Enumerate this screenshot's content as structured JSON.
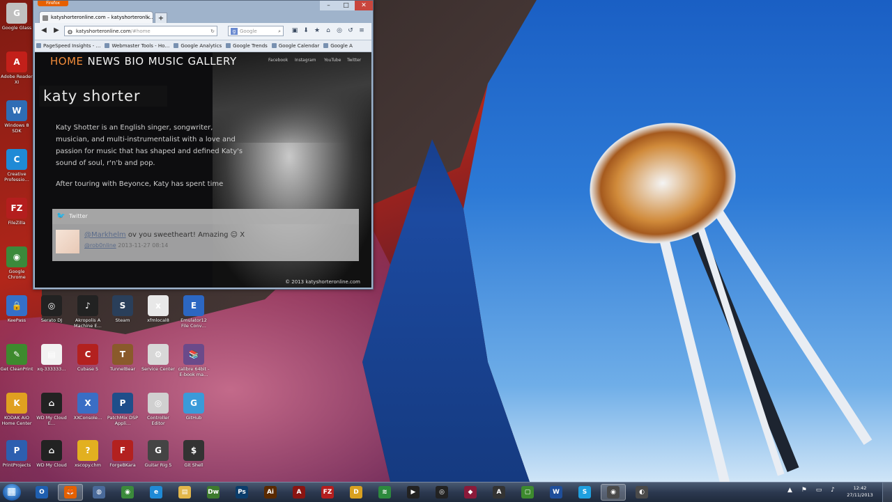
{
  "browser": {
    "app_button": "Firefox",
    "window_controls": {
      "minimize": "–",
      "maximize": "□",
      "close": "✕"
    },
    "tab": {
      "title": "katyshorteronline.com – katyshorteronli…",
      "close": "✕"
    },
    "new_tab": "+",
    "url": {
      "host": "katyshorteronline.com",
      "path": "/#home"
    },
    "search_placeholder": "Google",
    "bookmarks": [
      "PageSpeed Insights - …",
      "Webmaster Tools - Ho…",
      "Google Analytics",
      "Google Trends",
      "Google Calendar",
      "Google A"
    ]
  },
  "site": {
    "nav": [
      "HOME",
      "NEWS",
      "BIO",
      "MUSIC",
      "GALLERY"
    ],
    "active_nav": "HOME",
    "social": [
      "Facebook",
      "Instagram",
      "YouTube",
      "Twitter"
    ],
    "logo": "katy shorter",
    "bio_paragraph_1": "Katy Shotter is an English singer, songwriter, musician, and multi-instrumentalist with a love and passion for music that has shaped and defined Katy's sound of soul, r'n'b and pop.",
    "bio_paragraph_2": "After touring with Beyonce, Katy has spent time",
    "tweet": {
      "account": "Twitter",
      "handle": "@Markhelm",
      "text": "ov you sweetheart! Amazing ☺ X",
      "via": "@rob0nline",
      "meta": "2013-11-27 08:14"
    },
    "footer": "© 2013 katyshorteronline.com"
  },
  "desktop_icons": [
    {
      "label": "Google Glass",
      "color": "#c0c0c0",
      "glyph": "G"
    },
    {
      "label": "Adobe Reader XI",
      "color": "#c3201a",
      "glyph": "A"
    },
    {
      "label": "Windows 8 SDK",
      "color": "#2f6db5",
      "glyph": "W"
    },
    {
      "label": "Creative Professio…",
      "color": "#1f8ad6",
      "glyph": "C"
    },
    {
      "label": "FileZilla",
      "color": "#b41e1e",
      "glyph": "FZ"
    },
    {
      "label": "Google Chrome",
      "color": "#3b8a3b",
      "glyph": "◉"
    },
    {
      "label": "KeePass",
      "color": "#3470c9",
      "glyph": "🔒"
    },
    {
      "label": "Serato DJ",
      "color": "#222222",
      "glyph": "◎"
    },
    {
      "label": "Akropolis A Machine E…",
      "color": "#222222",
      "glyph": "♪"
    },
    {
      "label": "Steam",
      "color": "#2a3f5a",
      "glyph": "S"
    },
    {
      "label": "xfmlocal8",
      "color": "#e8e8e8",
      "glyph": "x"
    },
    {
      "label": "Emulator12 File Conv…",
      "color": "#2c67c2",
      "glyph": "E"
    },
    {
      "label": "Get CleanPrint",
      "color": "#3e8a2e",
      "glyph": "✎"
    },
    {
      "label": "xq-333333…",
      "color": "#f2f2f2",
      "glyph": "▤"
    },
    {
      "label": "Cubase 5",
      "color": "#b3211f",
      "glyph": "C"
    },
    {
      "label": "TunnelBear",
      "color": "#8a5a2b",
      "glyph": "T"
    },
    {
      "label": "Service Center",
      "color": "#d8d8d8",
      "glyph": "⚙"
    },
    {
      "label": "calibre 64bit - E-book ma…",
      "color": "#6b4a8a",
      "glyph": "📚"
    },
    {
      "label": "KODAK AiO Home Center",
      "color": "#e0a020",
      "glyph": "K"
    },
    {
      "label": "WD My Cloud E…",
      "color": "#222222",
      "glyph": "⌂"
    },
    {
      "label": "XXConsole…",
      "color": "#3a6ec5",
      "glyph": "X"
    },
    {
      "label": "PatchMix DSP Appli…",
      "color": "#1f4e8a",
      "glyph": "P"
    },
    {
      "label": "Controller Editor",
      "color": "#d0d0d0",
      "glyph": "◎"
    },
    {
      "label": "GitHub",
      "color": "#3a9ad9",
      "glyph": "G"
    },
    {
      "label": "PrintProjects",
      "color": "#2d5fb0",
      "glyph": "P"
    },
    {
      "label": "WD My Cloud",
      "color": "#222222",
      "glyph": "⌂"
    },
    {
      "label": "xscopy.chm",
      "color": "#e2b020",
      "glyph": "?"
    },
    {
      "label": "ForgeBKara",
      "color": "#b3211f",
      "glyph": "F"
    },
    {
      "label": "Guitar Rig 5",
      "color": "#444444",
      "glyph": "G"
    },
    {
      "label": "Git Shell",
      "color": "#333333",
      "glyph": "$"
    }
  ],
  "taskbar": {
    "apps": [
      {
        "name": "outlook",
        "glyph": "O",
        "color": "#1f5fb0",
        "active": false
      },
      {
        "name": "firefox",
        "glyph": "🦊",
        "color": "#e66000",
        "active": true
      },
      {
        "name": "network",
        "glyph": "◍",
        "color": "#4a6a9a",
        "active": false
      },
      {
        "name": "chrome",
        "glyph": "◉",
        "color": "#3b8a3b",
        "active": false
      },
      {
        "name": "internet-explorer",
        "glyph": "e",
        "color": "#1f8ad6",
        "active": false
      },
      {
        "name": "explorer",
        "glyph": "▤",
        "color": "#e2b64a",
        "active": false
      },
      {
        "name": "dreamweaver",
        "glyph": "Dw",
        "color": "#3d7a2e",
        "active": false
      },
      {
        "name": "photoshop",
        "glyph": "Ps",
        "color": "#0b3d6b",
        "active": false
      },
      {
        "name": "illustrator",
        "glyph": "Ai",
        "color": "#5a2a00",
        "active": false
      },
      {
        "name": "reader",
        "glyph": "A",
        "color": "#8a1512",
        "active": false
      },
      {
        "name": "filezilla",
        "glyph": "FZ",
        "color": "#b41e1e",
        "active": false
      },
      {
        "name": "editor",
        "glyph": "D",
        "color": "#d8a020",
        "active": false
      },
      {
        "name": "spotify",
        "glyph": "≋",
        "color": "#2d8a3e",
        "active": false
      },
      {
        "name": "media",
        "glyph": "▶",
        "color": "#222222",
        "active": false
      },
      {
        "name": "serato",
        "glyph": "◎",
        "color": "#222222",
        "active": false
      },
      {
        "name": "app-red",
        "glyph": "◆",
        "color": "#8a1a3a",
        "active": false
      },
      {
        "name": "app-dark",
        "glyph": "A",
        "color": "#333333",
        "active": false
      },
      {
        "name": "app-green",
        "glyph": "▢",
        "color": "#3d8a2e",
        "active": false
      },
      {
        "name": "word",
        "glyph": "W",
        "color": "#1f4e9a",
        "active": false
      },
      {
        "name": "skype",
        "glyph": "S",
        "color": "#1fa0e0",
        "active": false
      },
      {
        "name": "app-eye",
        "glyph": "◉",
        "color": "#4a4a4a",
        "active": true
      },
      {
        "name": "app-misc",
        "glyph": "◐",
        "color": "#4a4a4a",
        "active": false
      }
    ],
    "tray": "▲ ⚑ ▭ ♪",
    "time": "12:42",
    "date": "27/11/2013"
  }
}
